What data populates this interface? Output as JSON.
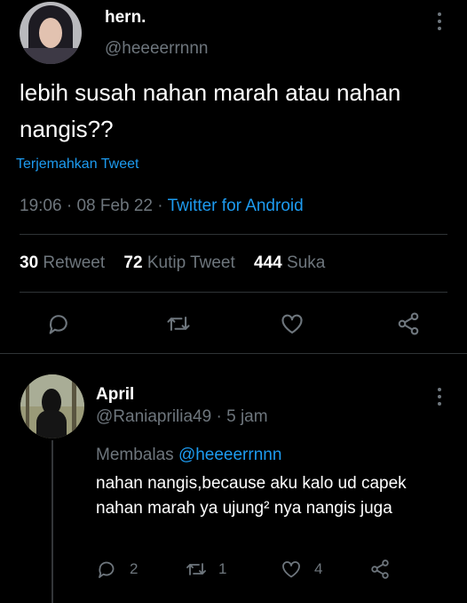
{
  "main_tweet": {
    "display_name": "hern.",
    "handle": "@heeeerrnnn",
    "text": "lebih susah nahan marah atau nahan nangis??",
    "translate_label": "Terjemahkan Tweet",
    "time": "19:06",
    "date": "08 Feb 22",
    "client": "Twitter for Android",
    "stats": {
      "retweets_count": "30",
      "retweets_label": "Retweet",
      "quotes_count": "72",
      "quotes_label": "Kutip Tweet",
      "likes_count": "444",
      "likes_label": "Suka"
    }
  },
  "reply": {
    "display_name": "April",
    "handle": "@Raniaprilia49",
    "age": "5 jam",
    "replying_label": "Membalas",
    "replying_to": "@heeeerrnnn",
    "text": "nahan nangis,because aku kalo ud capek nahan marah ya ujung² nya nangis juga",
    "reply_count": "2",
    "retweet_count": "1",
    "like_count": "4"
  },
  "colors": {
    "background": "#000000",
    "text": "#ffffff",
    "muted": "#6e767d",
    "accent": "#1d9bf0",
    "divider": "#2f3336"
  },
  "icons": [
    "more-icon",
    "reply-icon",
    "retweet-icon",
    "like-icon",
    "share-icon"
  ]
}
